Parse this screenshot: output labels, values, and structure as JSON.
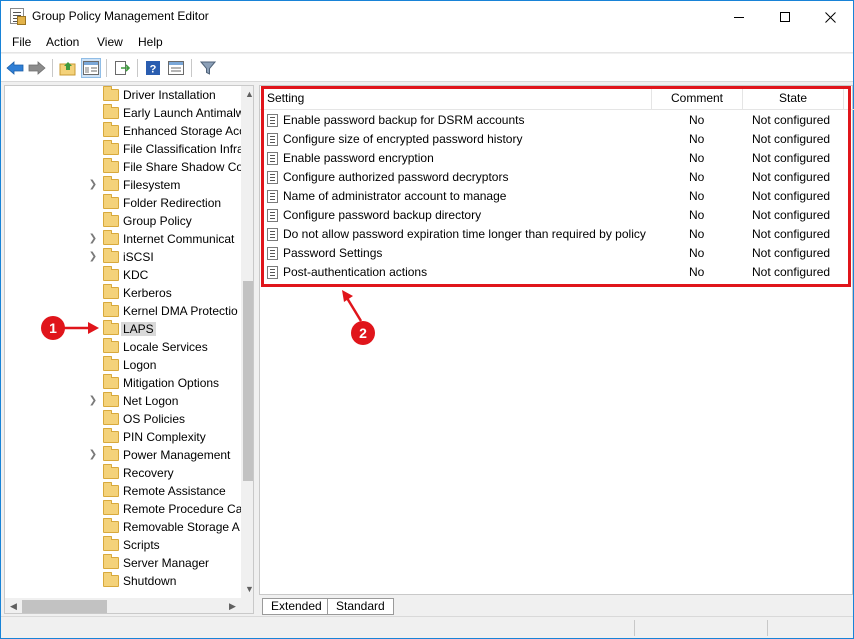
{
  "window": {
    "title": "Group Policy Management Editor"
  },
  "menu": [
    {
      "label": "File"
    },
    {
      "label": "Action"
    },
    {
      "label": "View"
    },
    {
      "label": "Help"
    }
  ],
  "toolbar": {
    "icons": [
      "back-icon",
      "forward-icon",
      "up-folder-icon",
      "show-hide-tree-icon",
      "export-list-icon",
      "help-icon",
      "properties-icon",
      "filter-icon"
    ]
  },
  "tree": {
    "items": [
      {
        "label": "Driver Installation",
        "expandable": false
      },
      {
        "label": "Early Launch Antimalw",
        "expandable": false
      },
      {
        "label": "Enhanced Storage Acc",
        "expandable": false
      },
      {
        "label": "File Classification Infra",
        "expandable": false
      },
      {
        "label": "File Share Shadow Co",
        "expandable": false
      },
      {
        "label": "Filesystem",
        "expandable": true
      },
      {
        "label": "Folder Redirection",
        "expandable": false
      },
      {
        "label": "Group Policy",
        "expandable": false
      },
      {
        "label": "Internet Communicat",
        "expandable": true
      },
      {
        "label": "iSCSI",
        "expandable": true
      },
      {
        "label": "KDC",
        "expandable": false
      },
      {
        "label": "Kerberos",
        "expandable": false
      },
      {
        "label": "Kernel DMA Protectio",
        "expandable": false
      },
      {
        "label": "LAPS",
        "expandable": false,
        "selected": true
      },
      {
        "label": "Locale Services",
        "expandable": false
      },
      {
        "label": "Logon",
        "expandable": false
      },
      {
        "label": "Mitigation Options",
        "expandable": false
      },
      {
        "label": "Net Logon",
        "expandable": true
      },
      {
        "label": "OS Policies",
        "expandable": false
      },
      {
        "label": "PIN Complexity",
        "expandable": false
      },
      {
        "label": "Power Management",
        "expandable": true
      },
      {
        "label": "Recovery",
        "expandable": false
      },
      {
        "label": "Remote Assistance",
        "expandable": false
      },
      {
        "label": "Remote Procedure Ca",
        "expandable": false
      },
      {
        "label": "Removable Storage A",
        "expandable": false
      },
      {
        "label": "Scripts",
        "expandable": false
      },
      {
        "label": "Server Manager",
        "expandable": false
      },
      {
        "label": "Shutdown",
        "expandable": false
      }
    ]
  },
  "list": {
    "columns": {
      "setting": "Setting",
      "comment": "Comment",
      "state": "State"
    },
    "rows": [
      {
        "setting": "Enable password backup for DSRM accounts",
        "comment": "No",
        "state": "Not configured"
      },
      {
        "setting": "Configure size of encrypted password history",
        "comment": "No",
        "state": "Not configured"
      },
      {
        "setting": "Enable password encryption",
        "comment": "No",
        "state": "Not configured"
      },
      {
        "setting": "Configure authorized password decryptors",
        "comment": "No",
        "state": "Not configured"
      },
      {
        "setting": "Name of administrator account to manage",
        "comment": "No",
        "state": "Not configured"
      },
      {
        "setting": "Configure password backup directory",
        "comment": "No",
        "state": "Not configured"
      },
      {
        "setting": "Do not allow password expiration time longer than required by policy",
        "comment": "No",
        "state": "Not configured"
      },
      {
        "setting": "Password Settings",
        "comment": "No",
        "state": "Not configured"
      },
      {
        "setting": "Post-authentication actions",
        "comment": "No",
        "state": "Not configured"
      }
    ]
  },
  "tabs": [
    {
      "label": "Extended"
    },
    {
      "label": "Standard"
    }
  ],
  "annotations": {
    "badge1": "1",
    "badge2": "2",
    "color": "#e0151b"
  }
}
